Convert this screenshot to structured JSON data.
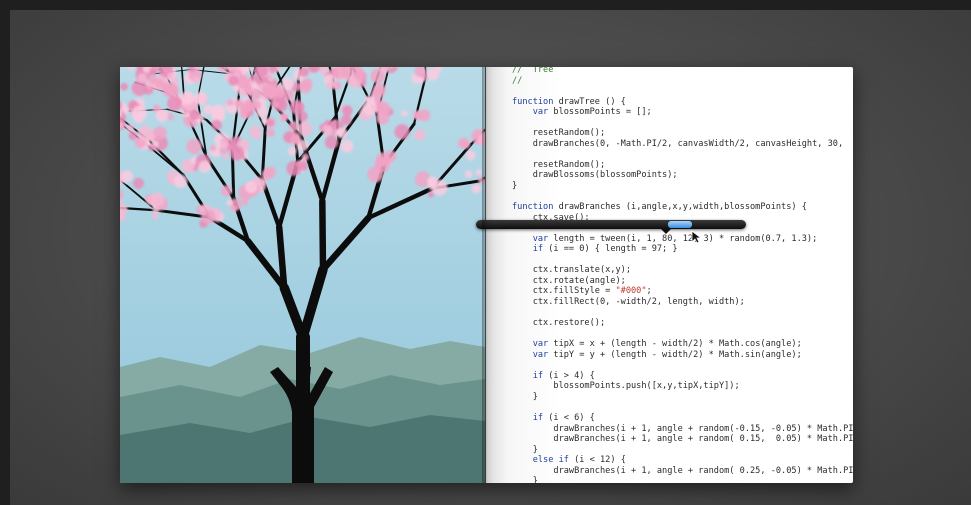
{
  "code_lines": [
    "//  Tree",
    "//",
    "",
    "function drawTree () {",
    "    var blossomPoints = [];",
    "",
    "    resetRandom();",
    "    drawBranches(0, -Math.PI/2, canvasWidth/2, canvasHeight, 30,",
    "",
    "    resetRandom();",
    "    drawBlossoms(blossomPoints);",
    "}",
    "",
    "function drawBranches (i,angle,x,y,width,blossomPoints) {",
    "    ctx.save();",
    "",
    "    var length = tween(i, 1, 80, 12, 3) * random(0.7, 1.3);",
    "    if (i == 0) { length = 97; }",
    "",
    "    ctx.translate(x,y);",
    "    ctx.rotate(angle);",
    "    ctx.fillStyle = \"#000\";",
    "    ctx.fillRect(0, -width/2, length, width);",
    "",
    "    ctx.restore();",
    "",
    "    var tipX = x + (length - width/2) * Math.cos(angle);",
    "    var tipY = y + (length - width/2) * Math.sin(angle);",
    "",
    "    if (i > 4) {",
    "        blossomPoints.push([x,y,tipX,tipY]);",
    "    }",
    "",
    "    if (i < 6) {",
    "        drawBranches(i + 1, angle + random(-0.15, -0.05) * Math.PI",
    "        drawBranches(i + 1, angle + random( 0.15,  0.05) * Math.PI",
    "    }",
    "    else if (i < 12) {",
    "        drawBranches(i + 1, angle + random( 0.25, -0.05) * Math.PI",
    "    }"
  ],
  "slider": {
    "value": 80,
    "position": 0.73
  },
  "colors": {
    "sky_top": "#b7d9e6",
    "sky_bottom": "#8ec4d9",
    "mountain_far": "#7fa59f",
    "mountain_mid": "#5f8a85",
    "mountain_near": "#47706c",
    "trunk": "#0d0d0d",
    "blossom": "#f2a3c6",
    "slider_thumb": "#5aa7ee"
  }
}
